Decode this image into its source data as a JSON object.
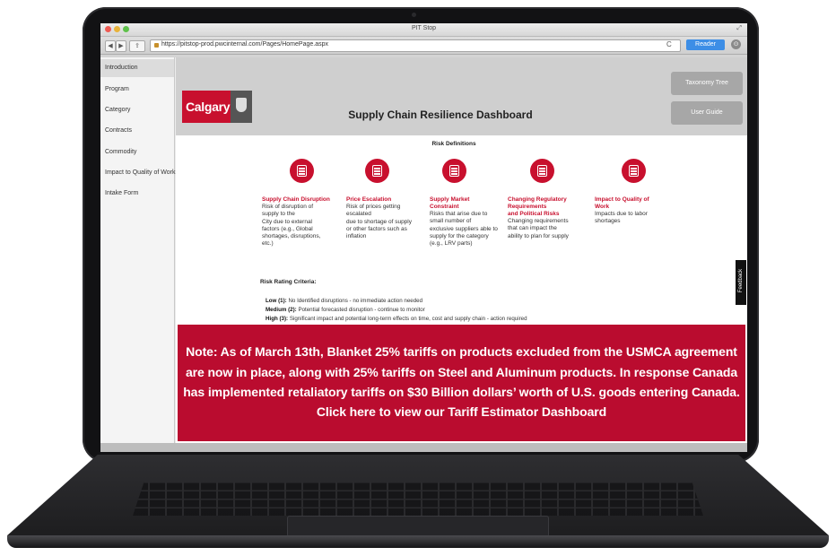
{
  "browser": {
    "window_title": "PIT Stop",
    "url": "https://pitstop-prod.pwcinternal.com/Pages/HomePage.aspx",
    "reader_label": "Reader",
    "back_glyph": "◀",
    "forward_glyph": "▶",
    "reload_glyph": "C",
    "resize_glyph": "⤢"
  },
  "sidebar": {
    "items": [
      {
        "label": "Introduction",
        "active": true
      },
      {
        "label": "Program"
      },
      {
        "label": "Category"
      },
      {
        "label": "Contracts"
      },
      {
        "label": "Commodity"
      },
      {
        "label": "Impact to Quality of Work"
      },
      {
        "label": "Intake Form"
      }
    ]
  },
  "header": {
    "logo_text": "Calgary",
    "title": "Supply Chain Resilience Dashboard",
    "buttons": [
      {
        "label": "Taxonomy Tree"
      },
      {
        "label": "User Guide"
      }
    ]
  },
  "risk_definitions": {
    "title": "Risk Definitions",
    "items": [
      {
        "heading": "Supply Chain Disruption",
        "icon": "supply-chain-icon",
        "description": "Risk of disruption of\nsupply to the\nCity due to external\nfactors (e.g., Global\nshortages, disruptions,\netc.)"
      },
      {
        "heading": "Price Escalation",
        "icon": "price-escalation-icon",
        "description": "Risk of prices getting\nescalated\ndue to shortage of supply\nor other factors such as\ninflation"
      },
      {
        "heading": "Supply Market\nConstraint",
        "icon": "market-constraint-icon",
        "description": "Risks that arise due to\nsmall number of\nexclusive suppliers able to\nsupply for the category\n(e.g., LRV parts)"
      },
      {
        "heading": "Changing Regulatory\nRequirements\nand Political Risks",
        "icon": "regulatory-icon",
        "description": "Changing requirements\nthat can impact the\nability to plan for supply"
      },
      {
        "heading": "Impact to Quality of\nWork",
        "icon": "quality-icon",
        "description": "Impacts due to labor\nshortages"
      }
    ]
  },
  "risk_rating": {
    "title": "Risk Rating Criteria:",
    "levels": [
      {
        "label": "Low (1):",
        "text": " No Identified disruptions - no immediate action needed"
      },
      {
        "label": "Medium (2):",
        "text": " Potential forecasted disruption - continue to monitor"
      },
      {
        "label": "High (3):",
        "text": " Significant impact and potential long-term effects on time, cost and supply chain - action required"
      }
    ]
  },
  "banner": {
    "lines": [
      "Note: As of March 13th, Blanket 25% tariffs on products excluded from the USMCA agreement",
      "are now in place, along with 25% tariffs on Steel and Aluminum products. In response Canada",
      "has implemented retaliatory tariffs on $30 Billion dollars’ worth of U.S. goods entering Canada.",
      "Click here to view our Tariff Estimator Dashboard"
    ]
  },
  "feedback_label": "Feedback",
  "colors": {
    "brand_red": "#c8102e",
    "banner_red": "#ba0c2f",
    "header_grey": "#cfcfcf",
    "button_grey": "#a7a7a7",
    "reader_blue": "#3d8ee6"
  }
}
